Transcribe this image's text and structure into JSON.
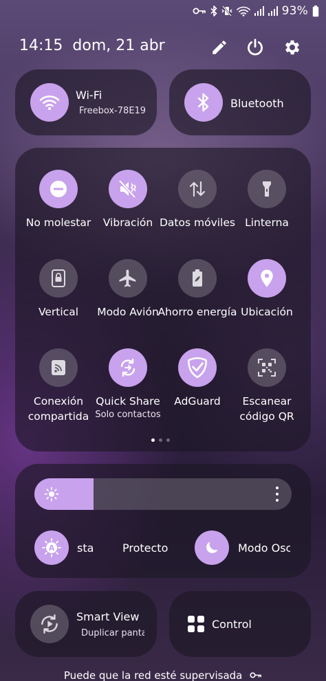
{
  "status_bar": {
    "battery_percent": "93%",
    "icons": [
      "vpn-key-icon",
      "bluetooth-icon",
      "vibrate-icon",
      "wifi-icon",
      "signal-icon",
      "signal-icon",
      "battery-icon"
    ]
  },
  "header": {
    "time": "14:15",
    "date": "dom, 21 abr",
    "edit_icon": "pencil-icon",
    "power_icon": "power-icon",
    "settings_icon": "gear-icon"
  },
  "wifi": {
    "title": "Wi-Fi",
    "subtitle": "Freebox-78E19",
    "state": "on"
  },
  "bluetooth": {
    "title": "Bluetooth",
    "state": "on"
  },
  "toggles": [
    {
      "label": "No molestar",
      "sub": "",
      "state": "on",
      "icon": "do-not-disturb-icon"
    },
    {
      "label": "Vibración",
      "sub": "",
      "state": "on",
      "icon": "vibrate-icon"
    },
    {
      "label": "Datos móviles",
      "sub": "",
      "state": "off",
      "icon": "mobile-data-icon"
    },
    {
      "label": "Linterna",
      "sub": "",
      "state": "off",
      "icon": "flashlight-icon"
    },
    {
      "label": "Vertical",
      "sub": "",
      "state": "off",
      "icon": "rotation-lock-icon"
    },
    {
      "label": "Modo Avión",
      "sub": "",
      "state": "off",
      "icon": "airplane-icon"
    },
    {
      "label": "Ahorro energía",
      "sub": "",
      "state": "off",
      "icon": "battery-saver-icon"
    },
    {
      "label": "Ubicación",
      "sub": "",
      "state": "on",
      "icon": "location-icon"
    },
    {
      "label": "Conexión compartida",
      "sub": "",
      "state": "off",
      "icon": "hotspot-icon"
    },
    {
      "label": "Quick Share",
      "sub": "Solo contactos",
      "state": "on",
      "icon": "quick-share-icon"
    },
    {
      "label": "AdGuard",
      "sub": "",
      "state": "on",
      "icon": "shield-check-icon"
    },
    {
      "label": "Escanear código QR",
      "sub": "",
      "state": "off",
      "icon": "qr-scan-icon"
    }
  ],
  "pager": {
    "pages": 3,
    "active": 0
  },
  "brightness": {
    "level": 0.23,
    "sun_icon": "sun-icon",
    "more_icon": "more-vertical-icon"
  },
  "display_chips": [
    {
      "label": "sta",
      "icon": "auto-brightness-icon",
      "state": "on"
    },
    {
      "label": "Protecto",
      "icon": "",
      "state": "off"
    },
    {
      "label": "Modo Osc",
      "icon": "moon-icon",
      "state": "on"
    }
  ],
  "smart_view": {
    "title": "Smart View",
    "subtitle": "Duplicar panta",
    "icon": "smart-view-icon"
  },
  "control": {
    "title": "Control",
    "icon": "grid-icon"
  },
  "footer": {
    "text": "Puede que la red esté supervisada",
    "icon": "vpn-key-icon"
  },
  "colors": {
    "accent": "#c8a2ec",
    "panel": "#1c1624",
    "icon_on": "#ffffff",
    "icon_off": "#dedae2"
  }
}
